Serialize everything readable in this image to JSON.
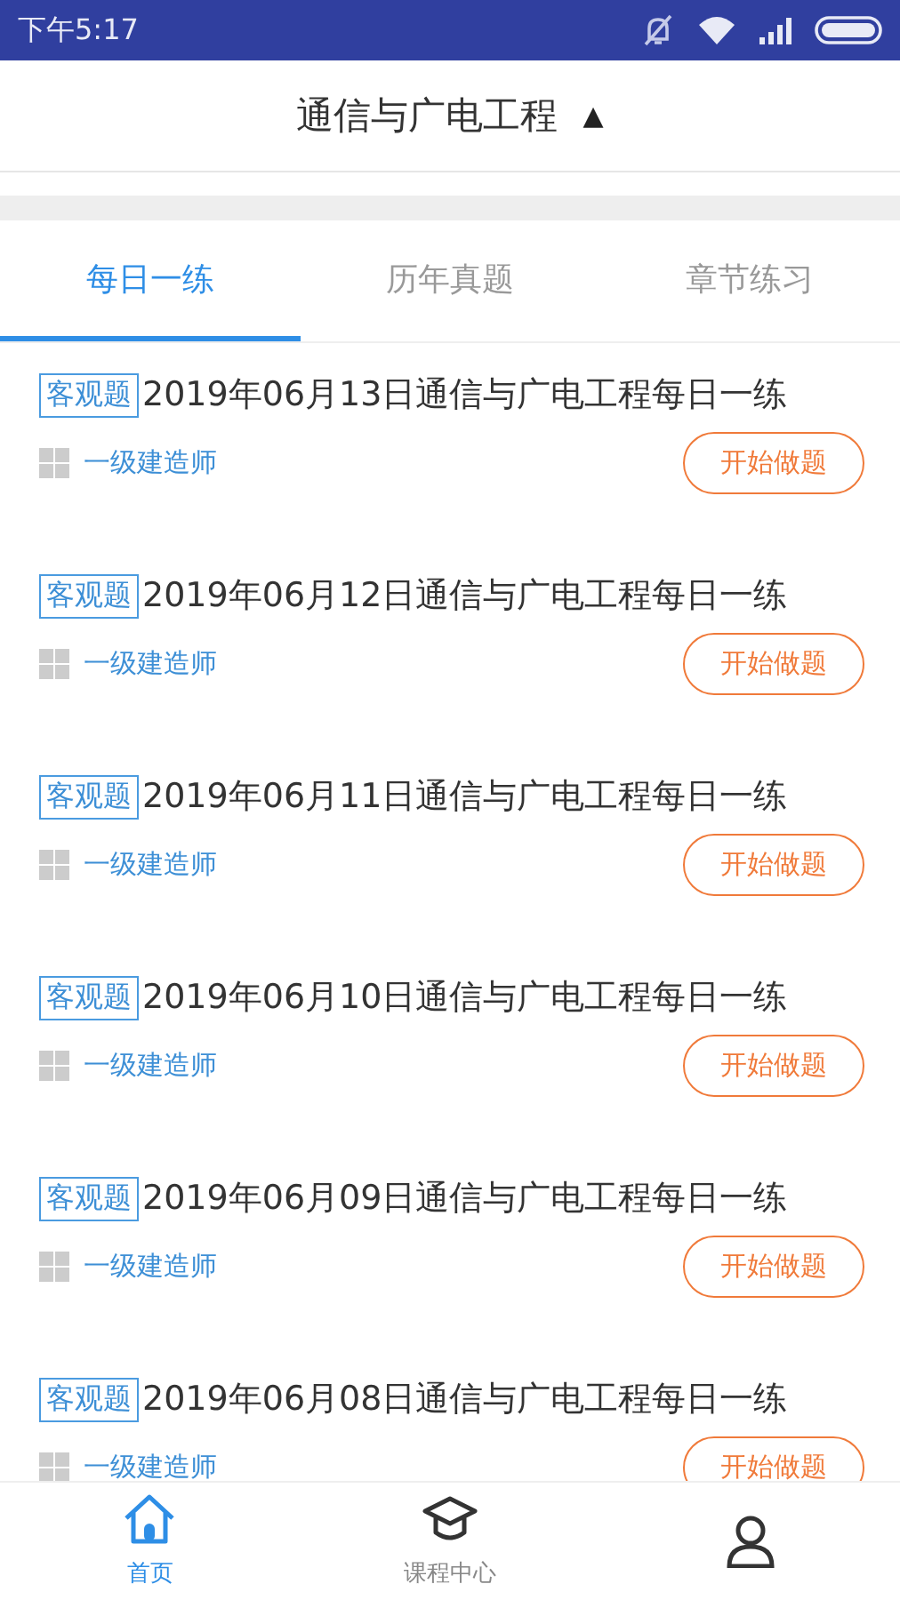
{
  "status_bar": {
    "time": "下午5:17"
  },
  "header": {
    "title": "通信与广电工程",
    "caret": "▲"
  },
  "tabs": [
    {
      "label": "每日一练",
      "selected": true
    },
    {
      "label": "历年真题",
      "selected": false
    },
    {
      "label": "章节练习",
      "selected": false
    }
  ],
  "items": [
    {
      "tag": "客观题",
      "title": "2019年06月13日通信与广电工程每日一练",
      "category": "一级建造师",
      "button": "开始做题"
    },
    {
      "tag": "客观题",
      "title": "2019年06月12日通信与广电工程每日一练",
      "category": "一级建造师",
      "button": "开始做题"
    },
    {
      "tag": "客观题",
      "title": "2019年06月11日通信与广电工程每日一练",
      "category": "一级建造师",
      "button": "开始做题"
    },
    {
      "tag": "客观题",
      "title": "2019年06月10日通信与广电工程每日一练",
      "category": "一级建造师",
      "button": "开始做题"
    },
    {
      "tag": "客观题",
      "title": "2019年06月09日通信与广电工程每日一练",
      "category": "一级建造师",
      "button": "开始做题"
    },
    {
      "tag": "客观题",
      "title": "2019年06月08日通信与广电工程每日一练",
      "category": "一级建造师",
      "button": "开始做题"
    }
  ],
  "bottom_nav": [
    {
      "kind": "home",
      "label": "首页",
      "selected": true
    },
    {
      "kind": "course",
      "label": "课程中心",
      "selected": false
    },
    {
      "kind": "profile",
      "selected": false
    }
  ]
}
